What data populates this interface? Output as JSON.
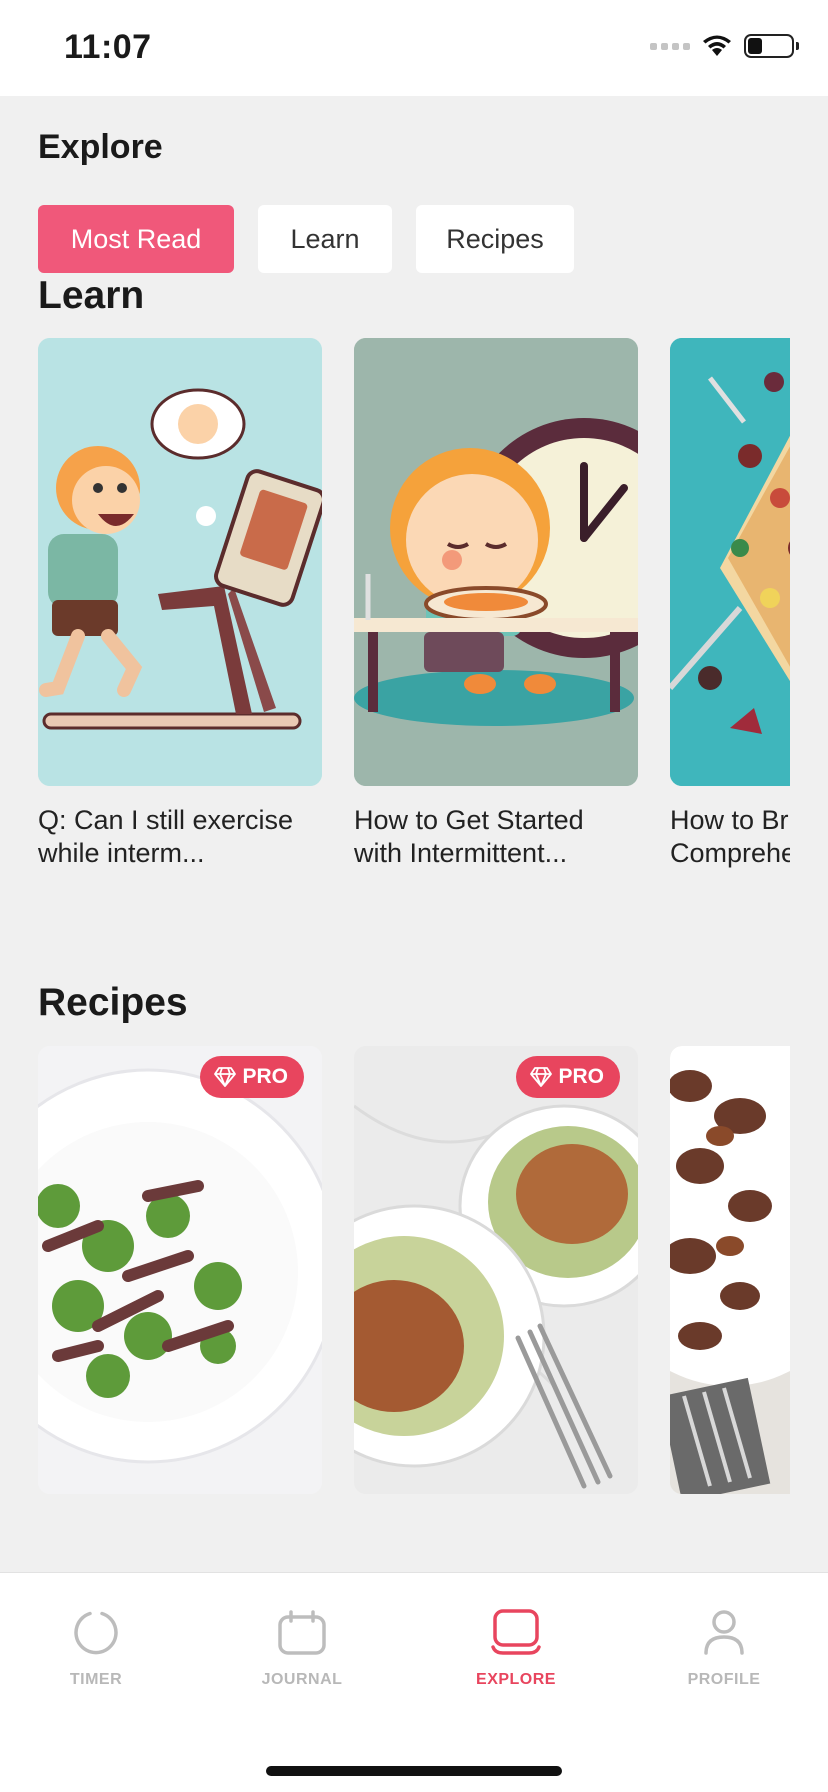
{
  "status": {
    "time": "11:07"
  },
  "header": {
    "title": "Explore"
  },
  "filters": [
    {
      "label": "Most Read",
      "active": true
    },
    {
      "label": "Learn",
      "active": false
    },
    {
      "label": "Recipes",
      "active": false
    }
  ],
  "learn": {
    "title": "Learn",
    "cards": [
      {
        "caption": "Q: Can I still exercise\nwhile interm...",
        "image": "cartoon-man-running-on-treadmill"
      },
      {
        "caption": "How to Get Started\nwith Intermittent...",
        "image": "cartoon-boy-at-table-with-clock"
      },
      {
        "caption": "How to Br\nComprehe",
        "image": "pizza-and-food-collage"
      }
    ]
  },
  "recipes": {
    "title": "Recipes",
    "cards": [
      {
        "badge": "PRO",
        "image": "beef-broccoli-stir-fry"
      },
      {
        "badge": "PRO",
        "image": "zucchini-noodles-bolognese"
      },
      {
        "badge": "",
        "image": "mushroom-stir-fry"
      }
    ]
  },
  "tabs": [
    {
      "label": "TIMER",
      "icon": "timer-icon",
      "active": false
    },
    {
      "label": "JOURNAL",
      "icon": "calendar-icon",
      "active": false
    },
    {
      "label": "EXPLORE",
      "icon": "explore-icon",
      "active": true
    },
    {
      "label": "PROFILE",
      "icon": "profile-icon",
      "active": false
    }
  ],
  "colors": {
    "accent": "#e8455e",
    "chip_active": "#f0587a",
    "background": "#f0f0f0"
  }
}
